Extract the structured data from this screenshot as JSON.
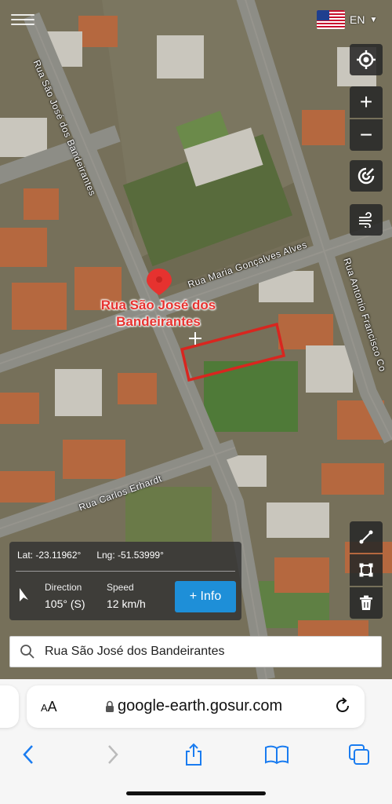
{
  "map": {
    "streets": {
      "sao_jose": "Rua São José dos Bandeirantes",
      "maria": "Rua Maria Gonçalves Alves",
      "antonio": "Rua Antonio Francisco Co",
      "carlos": "Rua Carlos Erhardt"
    },
    "pin_title": "Rua São José dos Bandeirantes",
    "colors": {
      "pin": "#e6322f",
      "selection": "#d8261f",
      "info_button": "#1e8fd8"
    }
  },
  "language": {
    "code": "EN",
    "flag": "us-flag-icon"
  },
  "controls": [
    {
      "name": "locate-button",
      "icon": "crosshair-icon"
    },
    {
      "name": "zoom-in-button",
      "icon": "plus-icon",
      "symbol": "+"
    },
    {
      "name": "zoom-out-button",
      "icon": "minus-icon",
      "symbol": "−"
    },
    {
      "name": "layers-button",
      "icon": "layers-icon"
    },
    {
      "name": "wind-button",
      "icon": "wind-icon"
    }
  ],
  "draw_tools": [
    {
      "name": "draw-line-button",
      "icon": "line-tool-icon"
    },
    {
      "name": "draw-polygon-button",
      "icon": "polygon-tool-icon"
    },
    {
      "name": "delete-button",
      "icon": "trash-icon"
    }
  ],
  "info": {
    "lat_label": "Lat:",
    "lat": "-23.11962°",
    "lng_label": "Lng:",
    "lng": "-51.53999°",
    "direction_label": "Direction",
    "direction": "105° (S)",
    "speed_label": "Speed",
    "speed": "12 km/h",
    "button": "+ Info"
  },
  "search": {
    "value": "Rua São José dos Bandeirantes"
  },
  "browser": {
    "text_size_label_small": "A",
    "text_size_label_big": "A",
    "url": "google-earth.gosur.com"
  }
}
